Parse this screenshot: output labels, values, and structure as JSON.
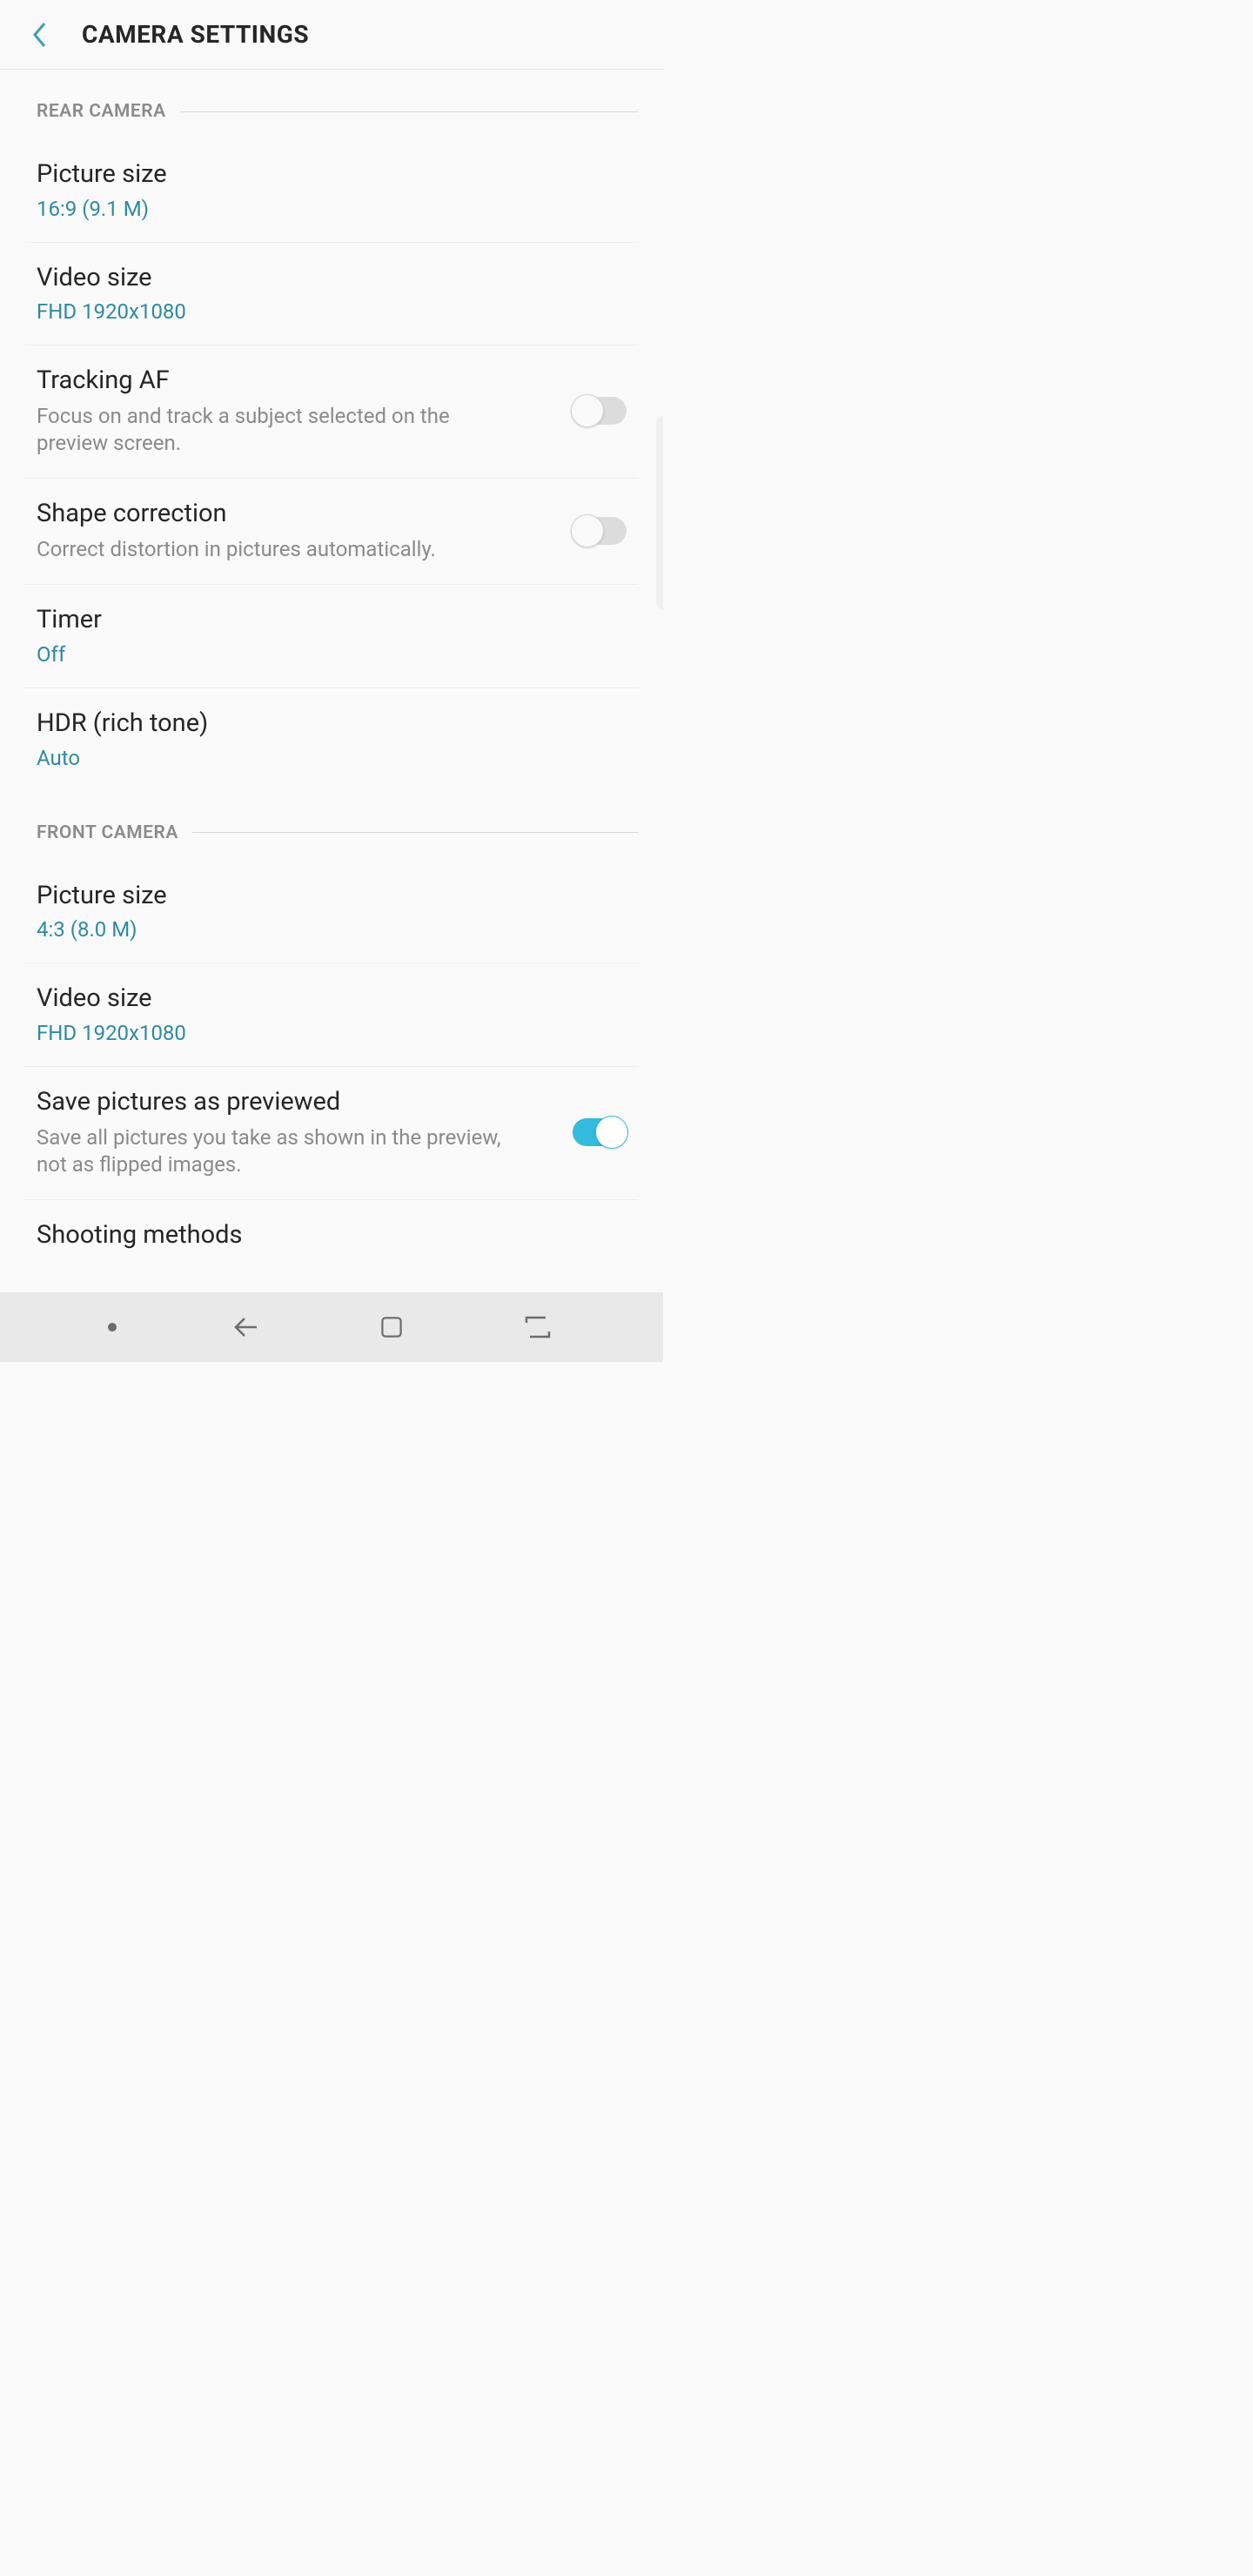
{
  "header": {
    "title": "CAMERA SETTINGS"
  },
  "sections": {
    "rear": {
      "label": "REAR CAMERA",
      "picture_size": {
        "title": "Picture size",
        "value": "16:9 (9.1 M)"
      },
      "video_size": {
        "title": "Video size",
        "value": "FHD 1920x1080"
      },
      "tracking_af": {
        "title": "Tracking AF",
        "desc": "Focus on and track a subject selected on the preview screen.",
        "on": false
      },
      "shape_corr": {
        "title": "Shape correction",
        "desc": "Correct distortion in pictures automatically.",
        "on": false
      },
      "timer": {
        "title": "Timer",
        "value": "Off"
      },
      "hdr": {
        "title": "HDR (rich tone)",
        "value": "Auto"
      }
    },
    "front": {
      "label": "FRONT CAMERA",
      "picture_size": {
        "title": "Picture size",
        "value": "4:3 (8.0 M)"
      },
      "video_size": {
        "title": "Video size",
        "value": "FHD 1920x1080"
      },
      "save_preview": {
        "title": "Save pictures as previewed",
        "desc": "Save all pictures you take as shown in the preview, not as flipped images.",
        "on": true
      },
      "shooting_methods": {
        "title": "Shooting methods"
      }
    }
  }
}
